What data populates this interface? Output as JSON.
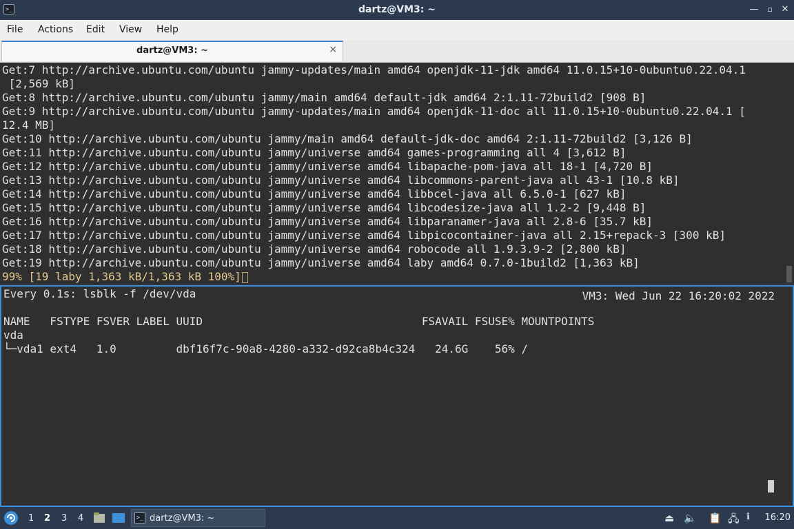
{
  "window": {
    "title": "dartz@VM3: ~"
  },
  "menu": [
    "File",
    "Actions",
    "Edit",
    "View",
    "Help"
  ],
  "tab": {
    "label": "dartz@VM3: ~",
    "close": "×"
  },
  "top_terminal": {
    "lines": [
      "Get:7 http://archive.ubuntu.com/ubuntu jammy-updates/main amd64 openjdk-11-jdk amd64 11.0.15+10-0ubuntu0.22.04.1",
      " [2,569 kB]",
      "Get:8 http://archive.ubuntu.com/ubuntu jammy/main amd64 default-jdk amd64 2:1.11-72build2 [908 B]",
      "Get:9 http://archive.ubuntu.com/ubuntu jammy-updates/main amd64 openjdk-11-doc all 11.0.15+10-0ubuntu0.22.04.1 [",
      "12.4 MB]",
      "Get:10 http://archive.ubuntu.com/ubuntu jammy/main amd64 default-jdk-doc amd64 2:1.11-72build2 [3,126 B]",
      "Get:11 http://archive.ubuntu.com/ubuntu jammy/universe amd64 games-programming all 4 [3,612 B]",
      "Get:12 http://archive.ubuntu.com/ubuntu jammy/universe amd64 libapache-pom-java all 18-1 [4,720 B]",
      "Get:13 http://archive.ubuntu.com/ubuntu jammy/universe amd64 libcommons-parent-java all 43-1 [10.8 kB]",
      "Get:14 http://archive.ubuntu.com/ubuntu jammy/universe amd64 libbcel-java all 6.5.0-1 [627 kB]",
      "Get:15 http://archive.ubuntu.com/ubuntu jammy/universe amd64 libcodesize-java all 1.2-2 [9,448 B]",
      "Get:16 http://archive.ubuntu.com/ubuntu jammy/universe amd64 libparanamer-java all 2.8-6 [35.7 kB]",
      "Get:17 http://archive.ubuntu.com/ubuntu jammy/universe amd64 libpicocontainer-java all 2.15+repack-3 [300 kB]",
      "Get:18 http://archive.ubuntu.com/ubuntu jammy/universe amd64 robocode all 1.9.3.9-2 [2,800 kB]",
      "Get:19 http://archive.ubuntu.com/ubuntu jammy/universe amd64 laby amd64 0.7.0-1build2 [1,363 kB]"
    ],
    "progress": "99% [19 laby 1,363 kB/1,363 kB 100%]"
  },
  "bottom_terminal": {
    "watch_cmd": "Every 0.1s: lsblk -f /dev/vda",
    "watch_host_time": "VM3: Wed Jun 22 16:20:02 2022",
    "header": "NAME   FSTYPE FSVER LABEL UUID                                 FSAVAIL FSUSE% MOUNTPOINTS",
    "row1": "vda",
    "row2": "└─vda1 ext4   1.0         dbf16f7c-90a8-4280-a332-d92ca8b4c324   24.6G    56% /"
  },
  "taskbar": {
    "workspaces": [
      "1",
      "2",
      "3",
      "4"
    ],
    "active_workspace": "2",
    "task_label": "dartz@VM3: ~",
    "clock": "16:20"
  },
  "colors": {
    "accent": "#3d8fd9",
    "panel": "#2b3a4e",
    "terminal_bg": "#2f2f2f"
  }
}
